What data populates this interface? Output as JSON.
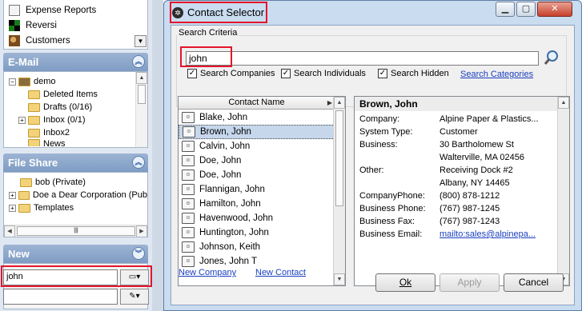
{
  "left": {
    "top_items": [
      {
        "label": "Expense Reports",
        "icon": "expense-icon"
      },
      {
        "label": "Reversi",
        "icon": "reversi-icon"
      },
      {
        "label": "Customers",
        "icon": "customers-icon"
      }
    ],
    "email": {
      "title": "E-Mail",
      "tree": [
        {
          "label": "demo",
          "level": 0
        },
        {
          "label": "Deleted Items",
          "level": 1
        },
        {
          "label": "Drafts (0/16)",
          "level": 1
        },
        {
          "label": "Inbox (0/1)",
          "level": 1
        },
        {
          "label": "Inbox2",
          "level": 1
        },
        {
          "label": "News",
          "level": 1
        }
      ]
    },
    "fileshare": {
      "title": "File Share",
      "tree": [
        {
          "label": "bob (Private)"
        },
        {
          "label": "Doe a Dear Corporation (Pub"
        },
        {
          "label": "Templates"
        }
      ]
    },
    "new": {
      "title": "New",
      "input_value": "john"
    }
  },
  "dialog": {
    "title": "Contact Selector",
    "search_criteria_label": "Search Criteria",
    "search_value": "john",
    "checkboxes": [
      {
        "label": "Search Companies",
        "checked": true
      },
      {
        "label": "Search Individuals",
        "checked": true
      },
      {
        "label": "Search Hidden",
        "checked": true
      }
    ],
    "search_categories_link": "Search Categories",
    "list_header": "Contact Name",
    "contacts": [
      {
        "name": "Blake, John",
        "selected": false
      },
      {
        "name": "Brown, John",
        "selected": true
      },
      {
        "name": "Calvin, John",
        "selected": false
      },
      {
        "name": "Doe, John",
        "selected": false
      },
      {
        "name": "Doe, John",
        "selected": false
      },
      {
        "name": "Flannigan, John",
        "selected": false
      },
      {
        "name": "Hamilton, John",
        "selected": false
      },
      {
        "name": "Havenwood, John",
        "selected": false
      },
      {
        "name": "Huntington, John",
        "selected": false
      },
      {
        "name": "Johnson, Keith",
        "selected": false
      },
      {
        "name": "Jones, John T",
        "selected": false
      }
    ],
    "details": {
      "name": "Brown, John",
      "company_label": "Company:",
      "company": "Alpine Paper & Plastics...",
      "systype_label": "System Type:",
      "systype": "Customer",
      "business_label": "Business:",
      "business1": "30 Bartholomew St",
      "business2": "Walterville, MA 02456",
      "other_label": "Other:",
      "other1": "Receiving Dock #2",
      "other2": "Albany, NY 14465",
      "cphone_label": "CompanyPhone:",
      "cphone": "(800) 878-1212",
      "bphone_label": "Business Phone:",
      "bphone": "(767) 987-1245",
      "bfax_label": "Business Fax:",
      "bfax": "(767) 987-1243",
      "bemail_label": "Business Email:",
      "bemail": "mailto:sales@alpinepa..."
    },
    "new_company_link": "New Company",
    "new_contact_link": "New Contact",
    "ok_label": "Ok",
    "apply_label": "Apply",
    "cancel_label": "Cancel"
  },
  "colors": {
    "accent": "#e3152b",
    "link": "#1a3fbf",
    "section": "#8aa5c9"
  }
}
